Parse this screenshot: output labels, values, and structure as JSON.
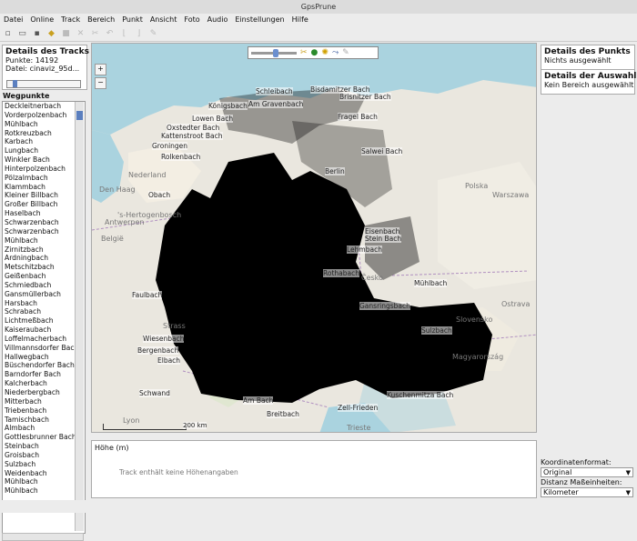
{
  "window": {
    "title": "GpsPrune"
  },
  "menu": [
    "Datei",
    "Online",
    "Track",
    "Bereich",
    "Punkt",
    "Ansicht",
    "Foto",
    "Audio",
    "Einstellungen",
    "Hilfe"
  ],
  "toolbar_icons": [
    "new-file-icon",
    "open-folder-icon",
    "save-icon",
    "eraser-icon",
    "delete-icon",
    "delete-range-icon",
    "cut-icon",
    "undo-icon",
    "crop-start-icon",
    "crop-end-icon",
    "edit-icon"
  ],
  "track_details": {
    "title": "Details des Tracks",
    "points": "Punkte: 14192",
    "file": "Datei: cinaviz_95d..."
  },
  "waypoints": {
    "label": "Wegpunkte",
    "items": [
      "Deckleitnerbach",
      "Vorderpolzenbach",
      "Mühlbach",
      "Rotkreuzbach",
      "Karbach",
      "Lungbach",
      "Winkler Bach",
      "Hinterpolzenbach",
      "Pölzalmbach",
      "Klammbach",
      "Kleiner Billbach",
      "Großer Billbach",
      "Haselbach",
      "Schwarzenbach",
      "Schwarzenbach",
      "Mühlbach",
      "Zirnitzbach",
      "Ardningbach",
      "Metschitzbach",
      "Geißenbach",
      "Schmiedbach",
      "Gansmüllerbach",
      "Harsbach",
      "Schrabach",
      "Lichtmeßbach",
      "Kaiseraubach",
      "Loffelmacherbach",
      "Villmannsdorfer Bach",
      "Hallwegbach",
      "Büschendorfer Bach",
      "Barndorfer Bach",
      "Kalcherbach",
      "Niederbergbach",
      "Mitterbach",
      "Triebenbach",
      "Tamischbach",
      "Almbach",
      "Gottlesbrunner Bach",
      "Steinbach",
      "Groisbach",
      "Sulzbach",
      "Weidenbach",
      "Mühlbach",
      "Mühlbach"
    ]
  },
  "map": {
    "labels": {
      "schleibach": "Schleibach",
      "bisdamitzer": "Bisdamitzer Bach",
      "brisnitzer": "Brisnitzer Bach",
      "koenigsbach": "Königsbach",
      "amgravenbach": "Am Gravenbach",
      "loewen": "Lowen Bach",
      "fragel": "Fragel Bach",
      "oxstedter": "Oxstedter Bach",
      "kattenstroot": "Kattenstroot Bach",
      "groningen": "Groningen",
      "salwei": "Salwei Bach",
      "rolkenbach": "Rolkenbach",
      "berlin": "Berlin",
      "nederland": "Nederland",
      "polska": "Polska",
      "warszawa": "Warszawa",
      "denhaag": "Den Haag",
      "obach": "Obach",
      "hertogenbosch": "'s-Hertogenbosch",
      "antwerpen": "Antwerpen",
      "belgie": "België",
      "eisenbach": "Eisenbach",
      "steinbach": "Stein Bach",
      "lehmbach": "Lehmbach",
      "rothabach": "Rothabach",
      "cesko": "Česko",
      "muehlbach": "Mühlbach",
      "faulbach": "Faulbach",
      "gansringbach": "Gansringsbach",
      "ostrava": "Ostrava",
      "strasbourg": "Strass",
      "wiesenbach": "Wiesenbach",
      "bergenbach": "Bergenbach",
      "elbach": "Elbach",
      "salzbach": "Sulzbach",
      "slovensko": "Slovensko",
      "magyar": "Magyarország",
      "schwand": "Schwand",
      "ambach": "Am Bach",
      "zellfrieden": "Zell-Frieden",
      "kuschenmitz": "Kuschenmitza Bach",
      "trieste": "Trieste",
      "breitbach": "Breitbach",
      "lyon": "Lyon",
      "scale": "200 km"
    },
    "zoom_in": "+",
    "zoom_out": "−",
    "tool_icons": [
      "zoom-slider",
      "scissors-icon",
      "globe-icon",
      "sun-icon",
      "route-icon",
      "edit-map-icon"
    ]
  },
  "elevation": {
    "label": "Höhe (m)",
    "message": "Track enthält keine Höhenangaben"
  },
  "point_details": {
    "title": "Details des Punkts",
    "value": "Nichts ausgewählt"
  },
  "selection_details": {
    "title": "Details der Auswahl",
    "value": "Kein Bereich ausgewählt"
  },
  "coord_format": {
    "label": "Koordinatenformat:",
    "value": "Original"
  },
  "distance_units": {
    "label": "Distanz Maßeinheiten:",
    "value": "Kilometer"
  }
}
